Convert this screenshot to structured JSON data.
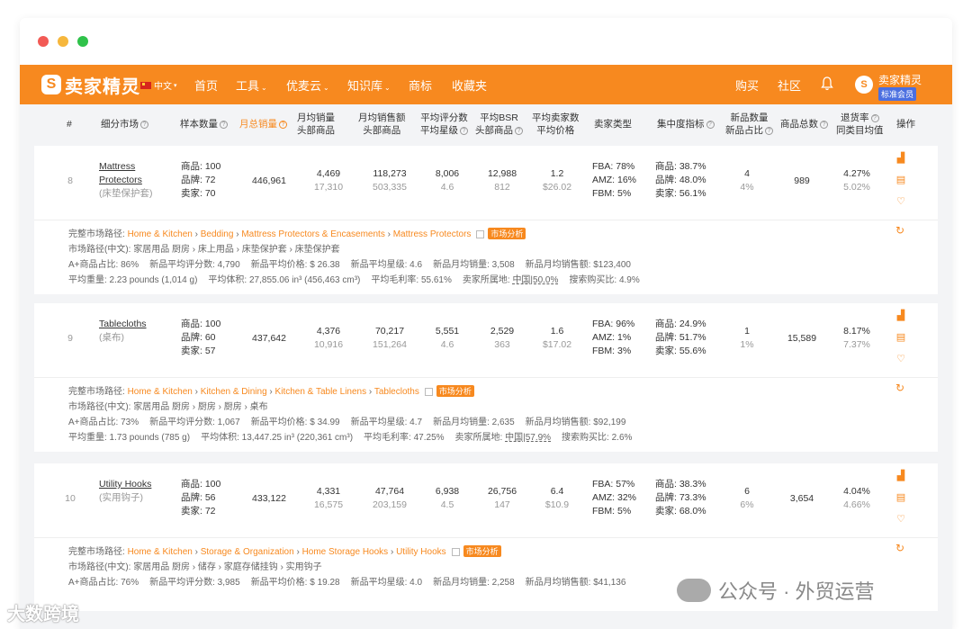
{
  "nav": {
    "logo_mark": "S",
    "logo_text": "卖家精灵",
    "lang": "中文",
    "items": [
      {
        "label": "首页",
        "chevron": false
      },
      {
        "label": "工具",
        "chevron": true
      },
      {
        "label": "优麦云",
        "chevron": true
      },
      {
        "label": "知识库",
        "chevron": true
      },
      {
        "label": "商标",
        "chevron": false
      },
      {
        "label": "收藏夹",
        "chevron": false
      }
    ],
    "right_items": [
      "购买",
      "社区"
    ],
    "user_name": "卖家精灵",
    "user_badge": "标准会员",
    "accent": "#f7891f"
  },
  "table": {
    "headers": {
      "index": "#",
      "market": "细分市场",
      "sample": "样本数量",
      "monthly_sales": "月总销量",
      "avg_sales_1": "月均销量",
      "avg_sales_2": "头部商品",
      "avg_revenue_1": "月均销售额",
      "avg_revenue_2": "头部商品",
      "avg_rating_1": "平均评分数",
      "avg_rating_2": "平均星级",
      "avg_bsr_1": "平均BSR",
      "avg_bsr_2": "头部商品",
      "avg_price_1": "平均卖家数",
      "avg_price_2": "平均价格",
      "seller_type": "卖家类型",
      "concentration": "集中度指标",
      "new_1": "新品数量",
      "new_2": "新品占比",
      "total": "商品总数",
      "return_1": "退货率",
      "return_2": "同类目均值",
      "ops": "操作"
    },
    "rows": [
      {
        "index": "8",
        "name_line1": "Mattress",
        "name_line2": "Protectors",
        "name_cn": "(床垫保护套)",
        "sample": [
          "商品: 100",
          "品牌: 72",
          "卖家: 70"
        ],
        "monthly_sales": "446,961",
        "avg_sales": "4,469",
        "avg_sales_sub": "17,310",
        "avg_revenue": "118,273",
        "avg_revenue_sub": "503,335",
        "avg_rating": "8,006",
        "avg_rating_sub": "4.6",
        "avg_bsr": "12,988",
        "avg_bsr_sub": "812",
        "avg_sellers": "1.2",
        "avg_price": "$26.02",
        "seller_type": [
          "FBA: 78%",
          "AMZ: 16%",
          "FBM: 5%"
        ],
        "concentration": [
          "商品: 38.7%",
          "品牌: 48.0%",
          "卖家: 56.1%"
        ],
        "new_count": "4",
        "new_ratio": "4%",
        "total": "989",
        "return_rate": "4.27%",
        "return_avg": "5.02%",
        "detail": {
          "path_label": "完整市场路径:",
          "path": [
            "Home & Kitchen",
            "Bedding",
            "Mattress Protectors & Encasements",
            "Mattress Protectors"
          ],
          "tag": "市场分析",
          "path_cn": "市场路径(中文): 家居用品 厨房 › 床上用品 › 床垫保护套 › 床垫保护套",
          "line3": [
            "A+商品占比: 86%",
            "新品平均评分数: 4,790",
            "新品平均价格: $ 26.38",
            "新品平均星级: 4.6",
            "新品月均销量: 3,508",
            "新品月均销售额: $123,400"
          ],
          "line4_a": "平均重量: 2.23 pounds (1,014 g)",
          "line4_b": "平均体积: 27,855.06 in³ (456,463 cm³)",
          "line4_c": "平均毛利率: 55.61%",
          "line4_d_label": "卖家所属地:",
          "line4_d_val": "中国|50.0%",
          "line4_e": "搜索购买比: 4.9%"
        }
      },
      {
        "index": "9",
        "name_line1": "Tablecloths",
        "name_line2": "",
        "name_cn": "(桌布)",
        "sample": [
          "商品: 100",
          "品牌: 60",
          "卖家: 57"
        ],
        "monthly_sales": "437,642",
        "avg_sales": "4,376",
        "avg_sales_sub": "10,916",
        "avg_revenue": "70,217",
        "avg_revenue_sub": "151,264",
        "avg_rating": "5,551",
        "avg_rating_sub": "4.6",
        "avg_bsr": "2,529",
        "avg_bsr_sub": "363",
        "avg_sellers": "1.6",
        "avg_price": "$17.02",
        "seller_type": [
          "FBA: 96%",
          "AMZ: 1%",
          "FBM: 3%"
        ],
        "concentration": [
          "商品: 24.9%",
          "品牌: 51.7%",
          "卖家: 55.6%"
        ],
        "new_count": "1",
        "new_ratio": "1%",
        "total": "15,589",
        "return_rate": "8.17%",
        "return_avg": "7.37%",
        "detail": {
          "path_label": "完整市场路径:",
          "path": [
            "Home & Kitchen",
            "Kitchen & Dining",
            "Kitchen & Table Linens",
            "Tablecloths"
          ],
          "tag": "市场分析",
          "path_cn": "市场路径(中文): 家居用品 厨房 › 厨房 › 厨房 › 桌布",
          "line3": [
            "A+商品占比: 73%",
            "新品平均评分数: 1,067",
            "新品平均价格: $ 34.99",
            "新品平均星级: 4.7",
            "新品月均销量: 2,635",
            "新品月均销售额: $92,199"
          ],
          "line4_a": "平均重量: 1.73 pounds (785 g)",
          "line4_b": "平均体积: 13,447.25 in³ (220,361 cm³)",
          "line4_c": "平均毛利率: 47.25%",
          "line4_d_label": "卖家所属地:",
          "line4_d_val": "中国|57.9%",
          "line4_e": "搜索购买比: 2.6%"
        }
      },
      {
        "index": "10",
        "name_line1": "Utility Hooks",
        "name_line2": "",
        "name_cn": "(实用钩子)",
        "sample": [
          "商品: 100",
          "品牌: 56",
          "卖家: 72"
        ],
        "monthly_sales": "433,122",
        "avg_sales": "4,331",
        "avg_sales_sub": "16,575",
        "avg_revenue": "47,764",
        "avg_revenue_sub": "203,159",
        "avg_rating": "6,938",
        "avg_rating_sub": "4.5",
        "avg_bsr": "26,756",
        "avg_bsr_sub": "147",
        "avg_sellers": "6.4",
        "avg_price": "$10.9",
        "seller_type": [
          "FBA: 57%",
          "AMZ: 32%",
          "FBM: 5%"
        ],
        "concentration": [
          "商品: 38.3%",
          "品牌: 73.3%",
          "卖家: 68.0%"
        ],
        "new_count": "6",
        "new_ratio": "6%",
        "total": "3,654",
        "return_rate": "4.04%",
        "return_avg": "4.66%",
        "detail": {
          "path_label": "完整市场路径:",
          "path": [
            "Home & Kitchen",
            "Storage & Organization",
            "Home Storage Hooks",
            "Utility Hooks"
          ],
          "tag": "市场分析",
          "path_cn": "市场路径(中文): 家居用品 厨房 › 储存 › 家庭存储挂钩 › 实用钩子",
          "line3": [
            "A+商品占比: 76%",
            "新品平均评分数: 3,985",
            "新品平均价格: $ 19.28",
            "新品平均星级: 4.0",
            "新品月均销量: 2,258",
            "新品月均销售额: $41,136"
          ]
        }
      }
    ]
  },
  "watermarks": {
    "left": "大数跨境",
    "right": "公众号 · 外贸运营"
  }
}
